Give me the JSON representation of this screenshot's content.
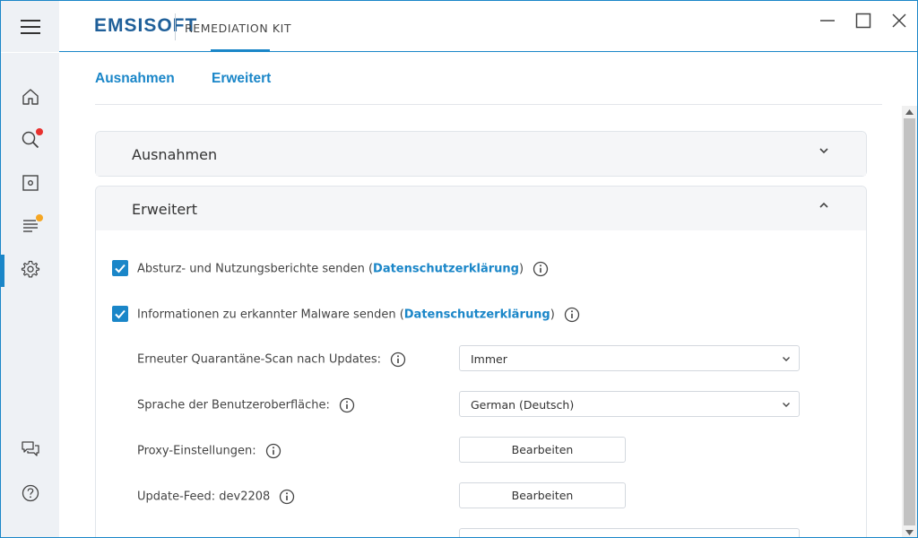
{
  "app": {
    "brand": "EMSISOFT",
    "product": "REMEDIATION KIT"
  },
  "tabs": [
    {
      "label": "Ausnahmen"
    },
    {
      "label": "Erweitert"
    }
  ],
  "panels": {
    "ausnahmen": {
      "title": "Ausnahmen"
    },
    "erweitert": {
      "title": "Erweitert",
      "checkboxes": [
        {
          "text": "Absturz- und Nutzungsberichte senden (",
          "link": "Datenschutzerklärung",
          "suffix": ")",
          "checked": true
        },
        {
          "text": "Informationen zu erkannter Malware senden (",
          "link": "Datenschutzerklärung",
          "suffix": ")",
          "checked": true
        }
      ],
      "settings": {
        "rescan": {
          "label": "Erneuter Quarantäne-Scan nach Updates:",
          "value": "Immer"
        },
        "language": {
          "label": "Sprache der Benutzeroberfläche:",
          "value": "German (Deutsch)"
        },
        "proxy": {
          "label": "Proxy-Einstellungen:",
          "button": "Bearbeiten"
        },
        "feed": {
          "label": "Update-Feed: dev2208",
          "button": "Bearbeiten"
        }
      }
    }
  },
  "colors": {
    "accent": "#1a86c8",
    "brand": "#1f5f99",
    "badge_red": "#e8312f",
    "badge_orange": "#f5a623"
  }
}
